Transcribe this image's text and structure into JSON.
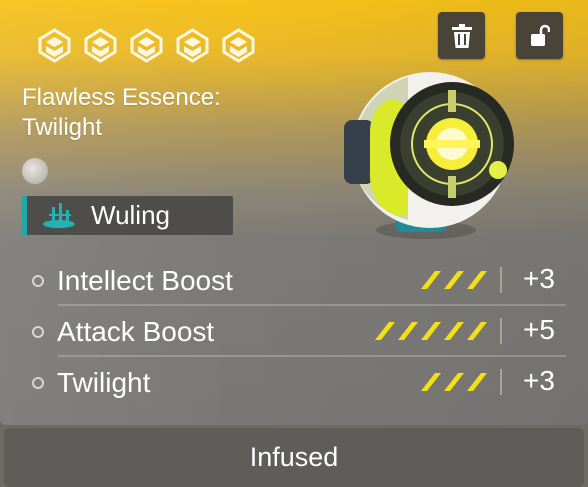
{
  "item": {
    "name": "Flawless Essence:\nTwilight",
    "rarity_stars": 5,
    "faction": "Wuling",
    "colors": {
      "accent": "#f6c21a",
      "faction_bar": "#23a6a6",
      "pip": "#f2df16"
    }
  },
  "actions": {
    "delete_icon": "trash-icon",
    "lock_icon": "unlock-icon"
  },
  "stats": [
    {
      "name": "Intellect Boost",
      "pips": 3,
      "value": "+3"
    },
    {
      "name": "Attack Boost",
      "pips": 5,
      "value": "+5"
    },
    {
      "name": "Twilight",
      "pips": 3,
      "value": "+3"
    }
  ],
  "status": {
    "label": "Infused"
  }
}
